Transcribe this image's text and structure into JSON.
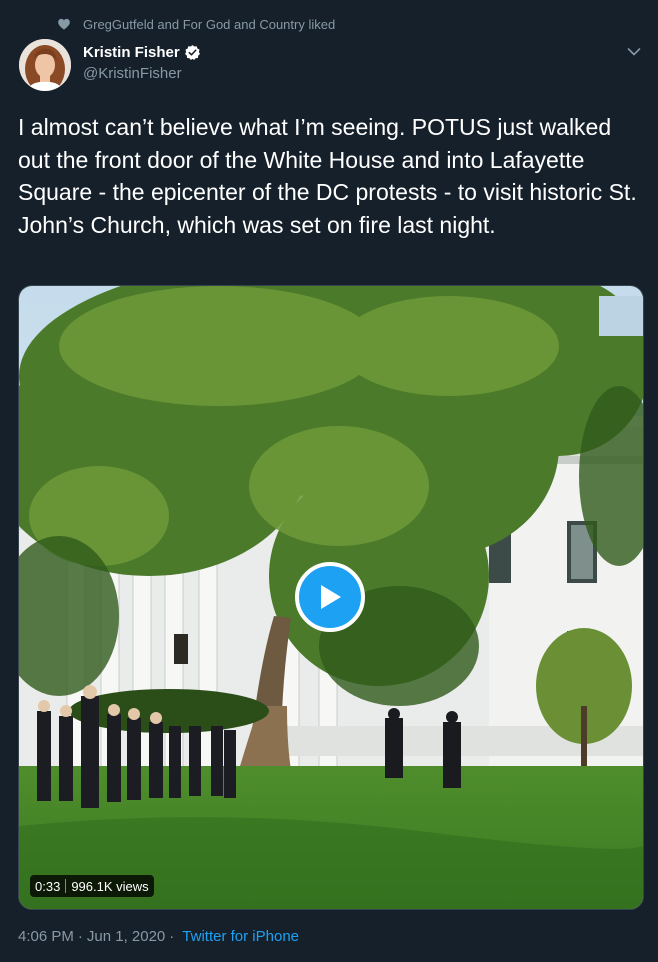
{
  "social_context": {
    "icon": "heart-icon",
    "text": "GregGutfeld and For God and Country liked"
  },
  "author": {
    "name": "Kristin Fisher",
    "handle": "@KristinFisher",
    "verified": true
  },
  "tweet": {
    "text": "I almost can’t believe what I’m seeing. POTUS just walked out the front door of the White House and into Lafayette Square - the epicenter of the DC protests - to visit historic St. John’s Church, which was set on fire last night."
  },
  "media": {
    "type": "video",
    "duration": "0:33",
    "views": "996.1K views"
  },
  "footer": {
    "time": "4:06 PM",
    "date": "Jun 1, 2020",
    "separator": "·",
    "source": "Twitter for iPhone"
  },
  "colors": {
    "background": "#15202b",
    "secondary_text": "#8899a6",
    "accent": "#1da1f2"
  }
}
